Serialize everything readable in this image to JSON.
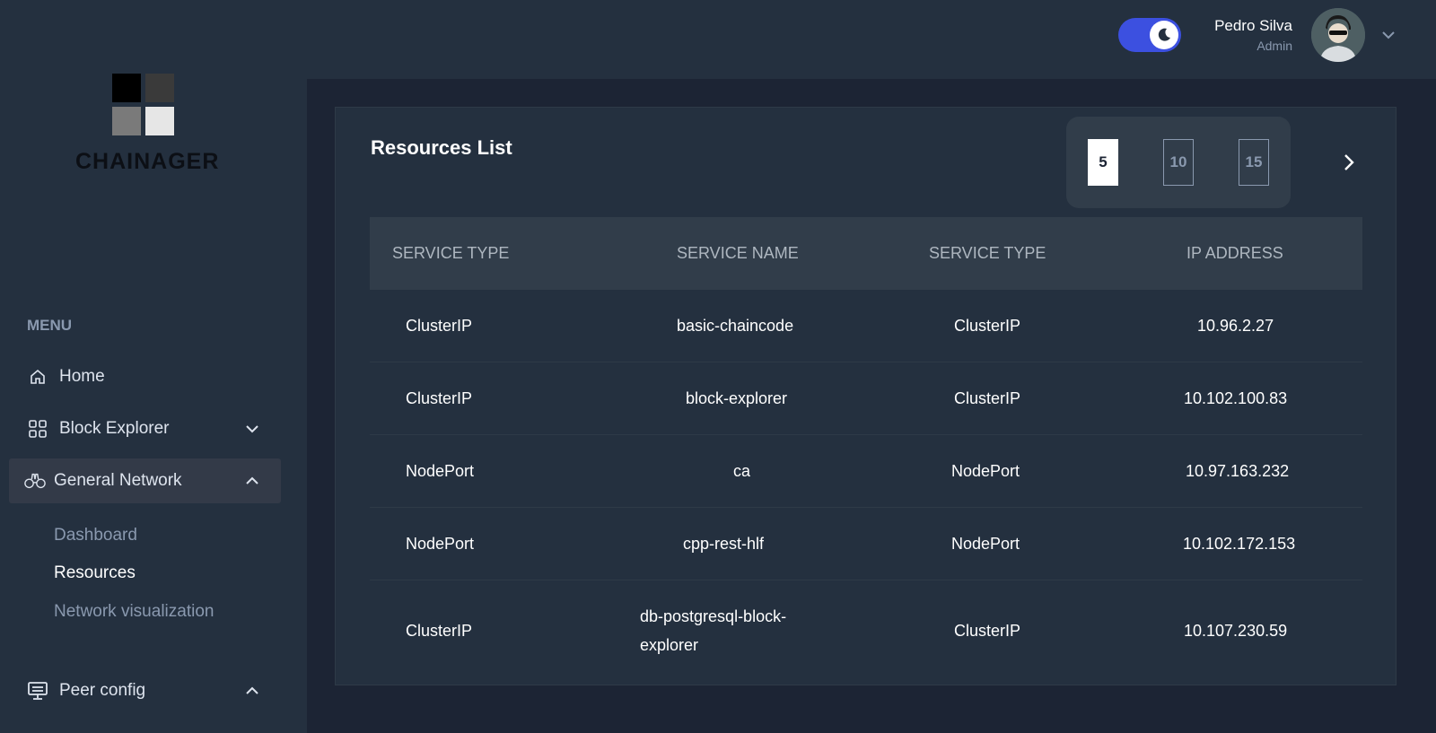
{
  "brand": {
    "name": "CHAINAGER",
    "colors": [
      "#000000",
      "#3a3a3a",
      "#7a7a7a",
      "#e6e6e6"
    ]
  },
  "sidebar": {
    "menu_heading": "MENU",
    "items": [
      {
        "label": "Home",
        "icon": "home-icon"
      },
      {
        "label": "Block Explorer",
        "icon": "grid-icon"
      },
      {
        "label": "General Network",
        "icon": "binoculars-icon"
      },
      {
        "label": "Peer config",
        "icon": "monitor-icon"
      }
    ],
    "sub_items": [
      {
        "label": "Dashboard"
      },
      {
        "label": "Resources"
      },
      {
        "label": "Network visualization"
      }
    ]
  },
  "header": {
    "dark_mode": true,
    "user_name": "Pedro Silva",
    "user_role": "Admin"
  },
  "resources": {
    "title": "Resources List",
    "page_sizes": [
      "5",
      "10",
      "15"
    ],
    "selected_page_size": "5",
    "columns": [
      "SERVICE TYPE",
      "SERVICE NAME",
      "SERVICE TYPE",
      "IP ADDRESS"
    ],
    "rows": [
      {
        "type": "ClusterIP",
        "name": "basic-chaincode",
        "type2": "ClusterIP",
        "ip": "10.96.2.27"
      },
      {
        "type": "ClusterIP",
        "name": "block-explorer",
        "type2": "ClusterIP",
        "ip": "10.102.100.83"
      },
      {
        "type": "NodePort",
        "name": "ca",
        "type2": "NodePort",
        "ip": "10.97.163.232"
      },
      {
        "type": "NodePort",
        "name": "cpp-rest-hlf",
        "type2": "NodePort",
        "ip": "10.102.172.153"
      },
      {
        "type": "ClusterIP",
        "name_line1": "db-postgresql-block-",
        "name_line2": "explorer",
        "type2": "ClusterIP",
        "ip": "10.107.230.59"
      }
    ]
  },
  "accent_color": "#3c50e0"
}
